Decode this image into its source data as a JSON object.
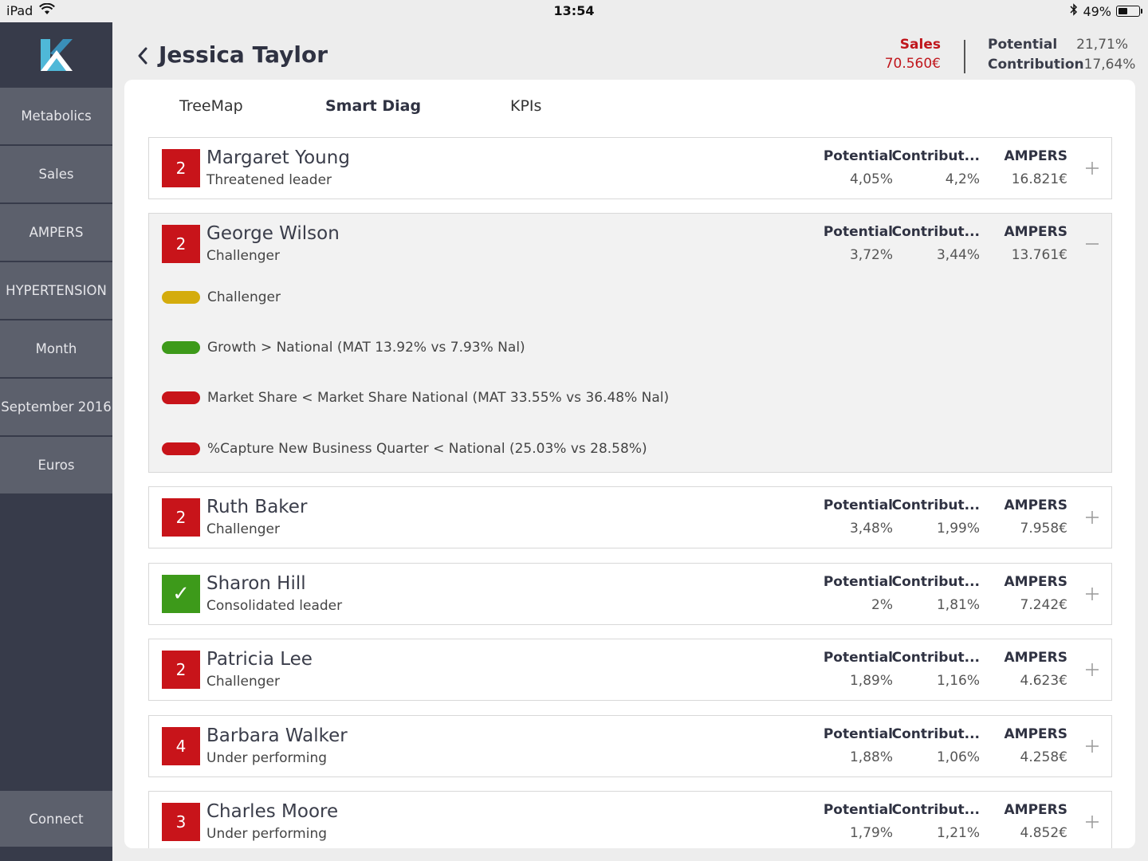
{
  "status_bar": {
    "device": "iPad",
    "time": "13:54",
    "battery": "49%",
    "battery_level": 0.49
  },
  "sidebar": {
    "items": [
      {
        "label": "Metabolics"
      },
      {
        "label": "Sales"
      },
      {
        "label": "AMPERS"
      },
      {
        "label": "HYPERTENSION"
      },
      {
        "label": "Month"
      },
      {
        "label": "September 2016"
      },
      {
        "label": "Euros"
      }
    ],
    "connect_label": "Connect"
  },
  "header": {
    "title": "Jessica Taylor",
    "sales_label": "Sales",
    "sales_value": "70.560€",
    "potential_label": "Potential",
    "potential_value": "21,71%",
    "contribution_label": "Contribution",
    "contribution_value": "17,64%"
  },
  "tabs": [
    {
      "label": "TreeMap",
      "active": false
    },
    {
      "label": "Smart Diag",
      "active": true
    },
    {
      "label": "KPIs",
      "active": false
    }
  ],
  "columns": {
    "potential": "Potential",
    "contribution": "Contribut...",
    "ampers": "AMPERS"
  },
  "rows": [
    {
      "badge": "2",
      "badge_color": "#c8141a",
      "name": "Margaret Young",
      "status": "Threatened leader",
      "potential": "4,05%",
      "contribution": "4,2%",
      "ampers": "16.821€",
      "expanded": false
    },
    {
      "badge": "2",
      "badge_color": "#c8141a",
      "name": "George Wilson",
      "status": "Challenger",
      "potential": "3,72%",
      "contribution": "3,44%",
      "ampers": "13.761€",
      "expanded": true,
      "diagnostics": [
        {
          "color": "#d4ac0d",
          "text": "Challenger"
        },
        {
          "color": "#3d9a1a",
          "text": "Growth > National (MAT 13.92% vs 7.93% Nal)"
        },
        {
          "color": "#c8141a",
          "text": "Market Share < Market Share National (MAT 33.55% vs 36.48% Nal)"
        },
        {
          "color": "#c8141a",
          "text": "%Capture New Business Quarter < National (25.03% vs 28.58%)"
        }
      ]
    },
    {
      "badge": "2",
      "badge_color": "#c8141a",
      "name": "Ruth Baker",
      "status": "Challenger",
      "potential": "3,48%",
      "contribution": "1,99%",
      "ampers": "7.958€",
      "expanded": false
    },
    {
      "badge": "✓",
      "badge_color": "#3d9a1a",
      "name": "Sharon Hill",
      "status": "Consolidated leader",
      "potential": "2%",
      "contribution": "1,81%",
      "ampers": "7.242€",
      "expanded": false
    },
    {
      "badge": "2",
      "badge_color": "#c8141a",
      "name": "Patricia Lee",
      "status": "Challenger",
      "potential": "1,89%",
      "contribution": "1,16%",
      "ampers": "4.623€",
      "expanded": false
    },
    {
      "badge": "4",
      "badge_color": "#c8141a",
      "name": "Barbara Walker",
      "status": "Under performing",
      "potential": "1,88%",
      "contribution": "1,06%",
      "ampers": "4.258€",
      "expanded": false
    },
    {
      "badge": "3",
      "badge_color": "#c8141a",
      "name": "Charles Moore",
      "status": "Under performing",
      "potential": "1,79%",
      "contribution": "1,21%",
      "ampers": "4.852€",
      "expanded": false
    }
  ]
}
